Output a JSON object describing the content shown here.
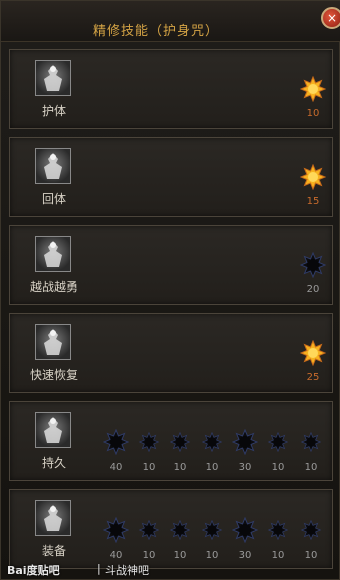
{
  "window": {
    "title": "精修技能（护身咒）",
    "close_label": "×"
  },
  "skills": [
    {
      "name": "护体",
      "nodes": [
        {
          "state": "active",
          "level": "10"
        }
      ]
    },
    {
      "name": "回体",
      "nodes": [
        {
          "state": "active",
          "level": "15"
        }
      ]
    },
    {
      "name": "越战越勇",
      "nodes": [
        {
          "state": "locked",
          "level": "20"
        }
      ]
    },
    {
      "name": "快速恢复",
      "nodes": [
        {
          "state": "active",
          "level": "25"
        }
      ]
    },
    {
      "name": "持久",
      "nodes": [
        {
          "state": "locked",
          "level": "40",
          "big": true
        },
        {
          "state": "locked",
          "level": "10"
        },
        {
          "state": "locked",
          "level": "10"
        },
        {
          "state": "locked",
          "level": "10"
        },
        {
          "state": "locked",
          "level": "30",
          "big": true
        },
        {
          "state": "locked",
          "level": "10"
        },
        {
          "state": "locked",
          "level": "10"
        }
      ]
    },
    {
      "name": "装备",
      "nodes": [
        {
          "state": "locked",
          "level": "40",
          "big": true
        },
        {
          "state": "locked",
          "level": "10"
        },
        {
          "state": "locked",
          "level": "10"
        },
        {
          "state": "locked",
          "level": "10"
        },
        {
          "state": "locked",
          "level": "30",
          "big": true
        },
        {
          "state": "locked",
          "level": "10"
        },
        {
          "state": "locked",
          "level": "10"
        }
      ]
    }
  ],
  "watermark": {
    "logo": "Bai度贴吧",
    "separator": "|",
    "text": "斗战神吧"
  },
  "colors": {
    "title": "#d5a445",
    "active_star": "#f7b21f",
    "level_active": "#c86b2c",
    "level_locked": "#9a9a9a"
  }
}
